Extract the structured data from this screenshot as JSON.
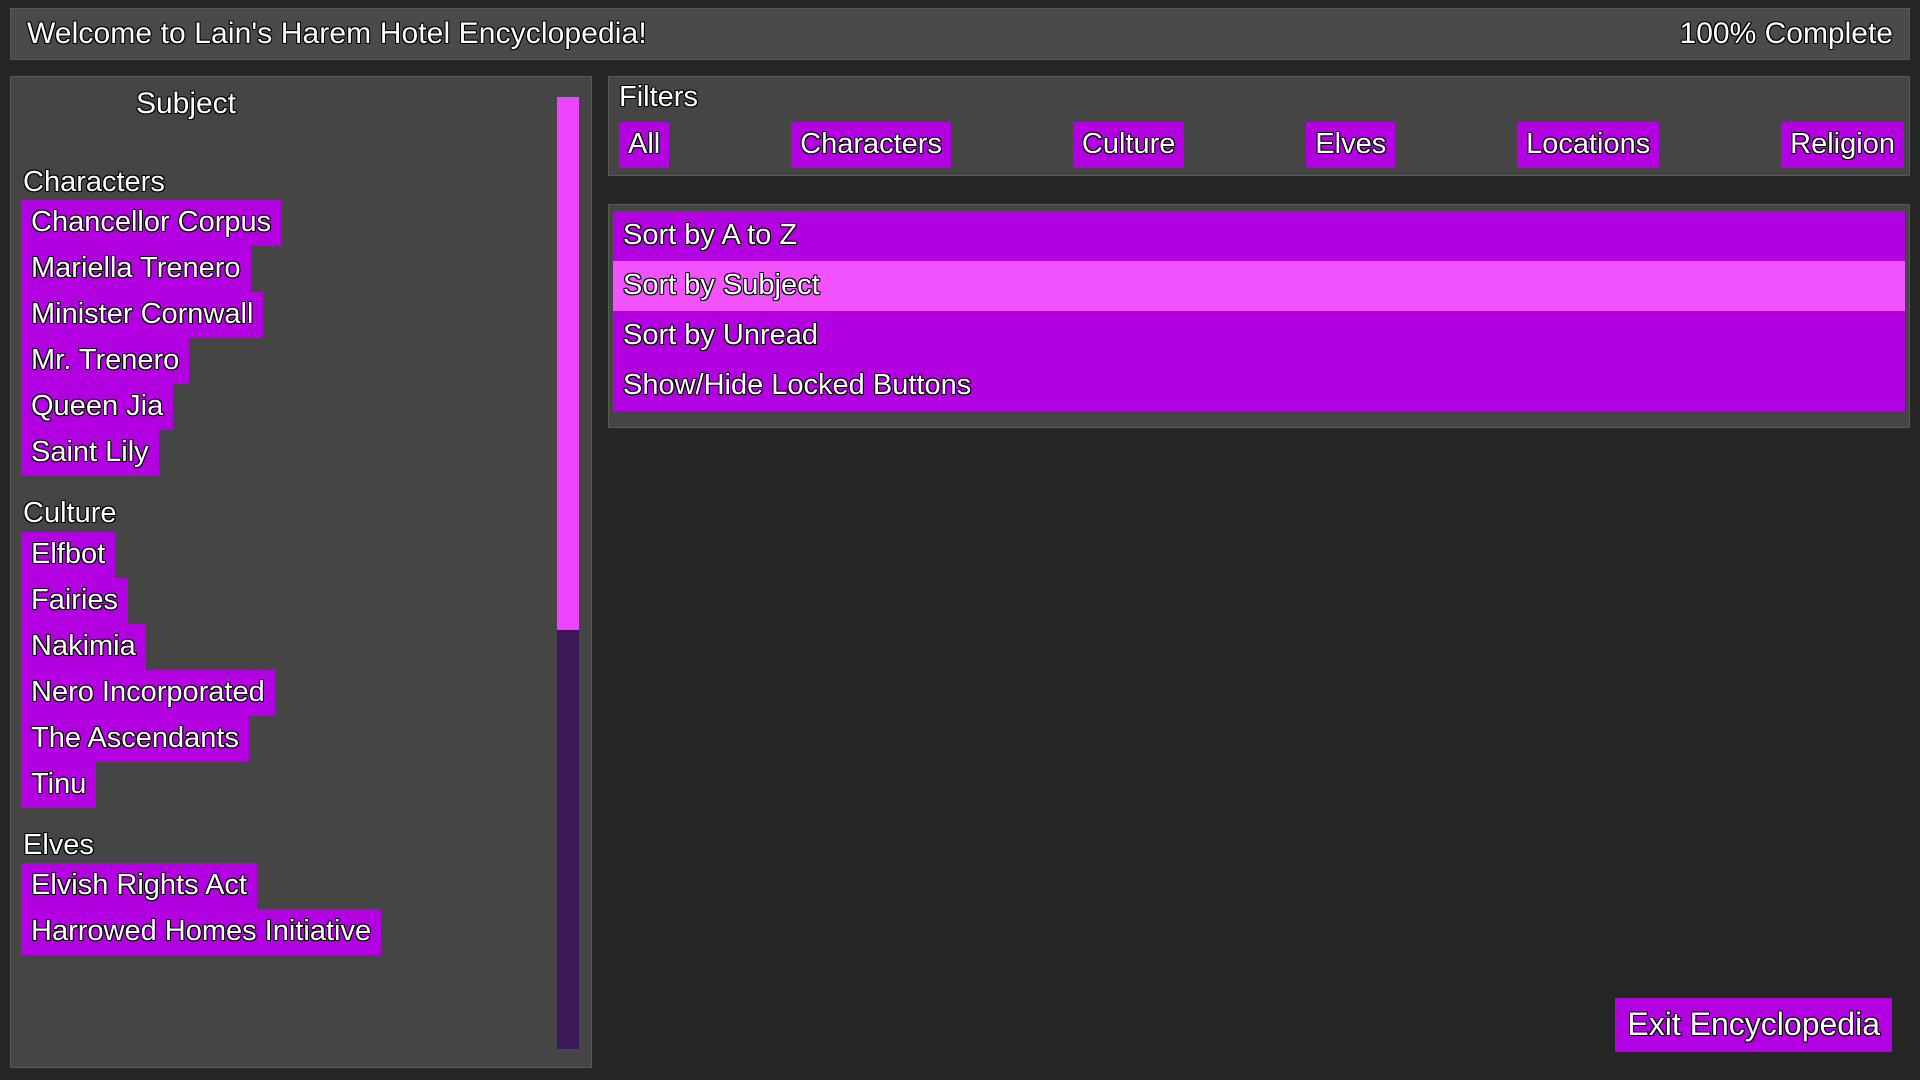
{
  "header": {
    "title": "Welcome to Lain's Harem Hotel Encyclopedia!",
    "progress": "100% Complete"
  },
  "sidebar": {
    "heading": "Subject",
    "groups": [
      {
        "label": "Characters",
        "entries": [
          "Chancellor Corpus",
          "Mariella Trenero",
          "Minister Cornwall",
          "Mr. Trenero",
          "Queen Jia",
          "Saint Lily"
        ]
      },
      {
        "label": "Culture",
        "entries": [
          "Elfbot",
          "Fairies",
          "Nakimia",
          "Nero Incorporated",
          "The Ascendants",
          "Tinu"
        ]
      },
      {
        "label": "Elves",
        "entries": [
          "Elvish Rights Act",
          "Harrowed Homes Initiative"
        ]
      }
    ],
    "scrollbar": {
      "thumb_fraction": 0.56
    }
  },
  "filters": {
    "label": "Filters",
    "buttons": [
      "All",
      "Characters",
      "Culture",
      "Elves",
      "Locations",
      "Religion"
    ]
  },
  "sort": {
    "options": [
      {
        "label": "Sort by A to Z",
        "selected": false
      },
      {
        "label": "Sort by Subject",
        "selected": true
      },
      {
        "label": "Sort by Unread",
        "selected": false
      },
      {
        "label": "Show/Hide Locked Buttons",
        "selected": false
      }
    ]
  },
  "footer": {
    "exit_label": "Exit Encyclopedia"
  },
  "colors": {
    "accent_purple": "#b300e0",
    "accent_magenta": "#ee44ff",
    "selected_row": "#f253ff",
    "panel_gray": "#454545",
    "header_gray": "#4a4a4a",
    "page_background": "#252525",
    "scrollbar_track": "#3b1857"
  }
}
